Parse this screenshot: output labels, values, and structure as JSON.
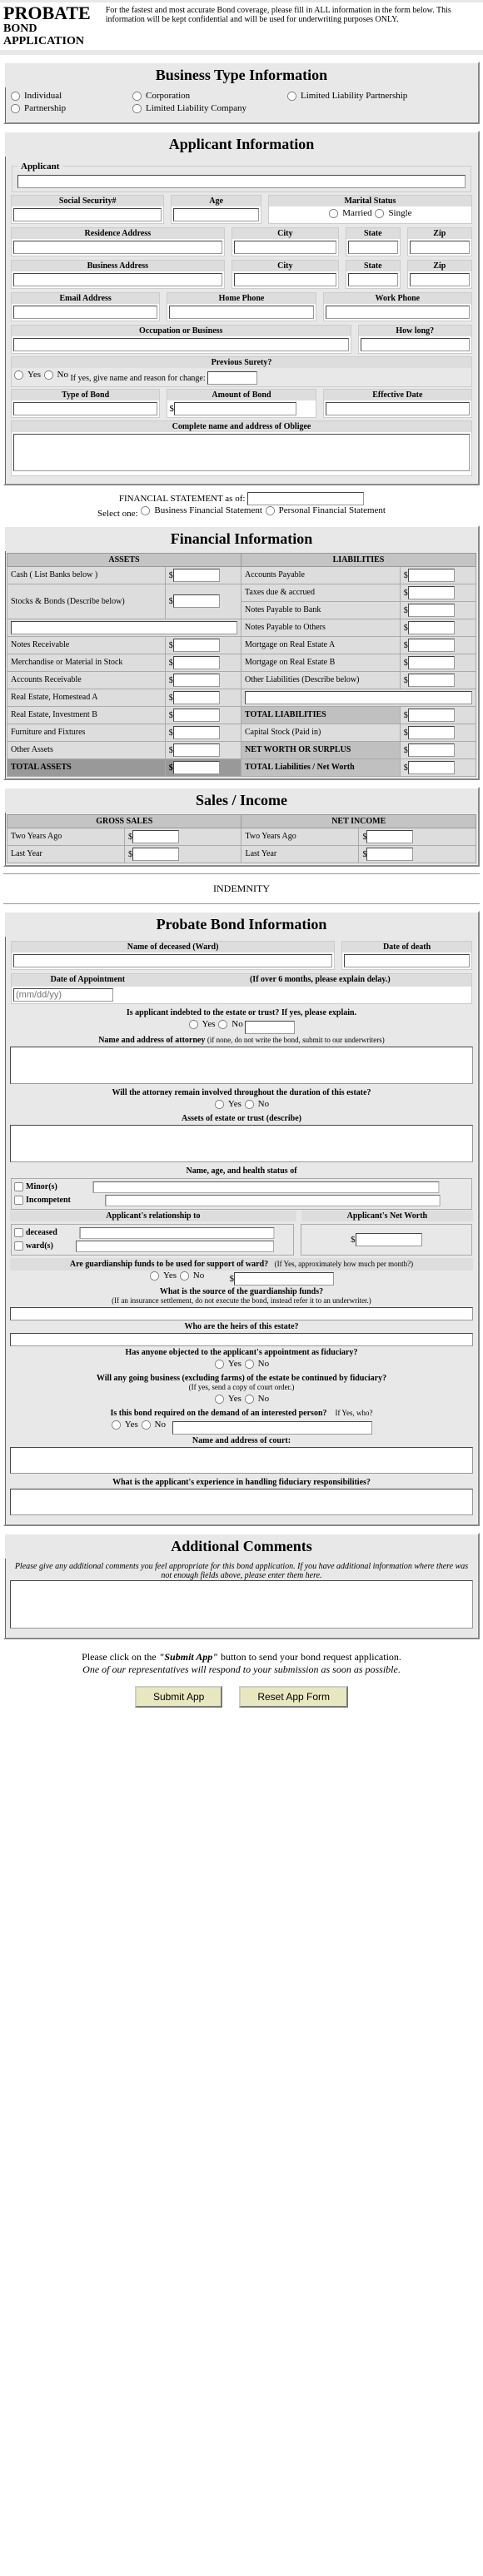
{
  "header": {
    "title_big": "PROBATE",
    "title_line2": "BOND",
    "title_line3": "APPLICATION",
    "subtitle": "For the fastest and most accurate Bond coverage, please fill in ALL information in the form below. This information will be kept confidential and will be used for underwriting purposes ONLY."
  },
  "biz": {
    "title": "Business Type Information",
    "o1": "Individual",
    "o2": "Corporation",
    "o3": "Limited Liability Partnership",
    "o4": "Partnership",
    "o5": "Limited Liability Company"
  },
  "app": {
    "title": "Applicant Information",
    "legend": "Applicant",
    "ssn": "Social Security#",
    "age": "Age",
    "marital": "Marital Status",
    "married": "Married",
    "single": "Single",
    "res": "Residence Address",
    "city": "City",
    "state": "State",
    "zip": "Zip",
    "bus": "Business Address",
    "email": "Email Address",
    "hphone": "Home Phone",
    "wphone": "Work Phone",
    "occ": "Occupation or Business",
    "howlong": "How long?",
    "surety": "Previous Surety?",
    "yes": "Yes",
    "no": "No",
    "surety_note": "If yes, give name and reason for change:",
    "btype": "Type of Bond",
    "bamt": "Amount of Bond",
    "bdate": "Effective Date",
    "obligee": "Complete name and address of Obligee"
  },
  "finstmt": {
    "label": "FINANCIAL STATEMENT as of:",
    "select": "Select one:",
    "o1": "Business Financial Statement",
    "o2": "Personal Financial Statement"
  },
  "fin": {
    "title": "Financial Information",
    "assets": "ASSETS",
    "liab": "LIABILITIES",
    "a1": "Cash ( List Banks below )",
    "a2": "Stocks & Bonds (Describe below)",
    "a3": "Notes Receivable",
    "a4": "Merchandise or Material in Stock",
    "a5": "Accounts Receivable",
    "a6": "Real Estate, Homestead A",
    "a7": "Real Estate, Investment B",
    "a8": "Furniture and Fixtures",
    "a9": "Other Assets",
    "at": "TOTAL ASSETS",
    "l1": "Accounts Payable",
    "l2": "Taxes due & accrued",
    "l3": "Notes Payable to Bank",
    "l4": "Notes Payable to Others",
    "l5": "Mortgage on Real Estate A",
    "l6": "Mortgage on Real Estate B",
    "l7": "Other Liabilities (Describe below)",
    "ltot": "TOTAL LIABILITIES",
    "l8": "Capital Stock (Paid in)",
    "l9": "NET WORTH OR SURPLUS",
    "lt": "TOTAL Liabilities / Net Worth"
  },
  "sales": {
    "title": "Sales / Income",
    "gross": "GROSS SALES",
    "net": "NET INCOME",
    "two": "Two Years Ago",
    "last": "Last Year"
  },
  "indem": "INDEMNITY",
  "prob": {
    "title": "Probate Bond Information",
    "q1": "Name of deceased (Ward)",
    "q1b": "Date of death",
    "q2": "Date of Appointment",
    "q2b": "(If over 6 months, please explain delay.)",
    "q2p": "(mm/dd/yy)",
    "q3": "Is applicant indebted to the estate or trust? If yes, please explain.",
    "yes": "Yes",
    "no": "No",
    "q4": "Name and address of attorney",
    "q4s": "(if none, do not write the bond, submit to our underwriters)",
    "q5": "Will the attorney remain involved throughout the duration of this estate?",
    "q6": "Assets of estate or trust (describe)",
    "q7": "Name, age, and health status of",
    "q7a": "Minor(s)",
    "q7b": "Incompetent",
    "q8a": "Applicant's relationship to",
    "q8b": "Applicant's Net Worth",
    "q8c": "deceased",
    "q8d": "ward(s)",
    "dollar": "$",
    "q9": "Are guardianship funds to be used for support of ward?",
    "q9b": "(If Yes, approximately how much per month?)",
    "q10": "What is the source of the guardianship funds?",
    "q10s": "(If an insurance settlement, do not execute the bond, instead refer it to an underwriter.)",
    "q11": "Who are the heirs of this estate?",
    "q12": "Has anyone objected to the applicant's appointment as fiduciary?",
    "q13": "Will any going business (excluding farms) of the estate be continued by fiduciary?",
    "q13s": "(If yes, send a copy of court order.)",
    "q14": "Is this bond required on the demand of an interested person?",
    "q14b": "If Yes, who?",
    "q15": "Name and address of court:",
    "q16": "What is the applicant's experience in handling fiduciary responsibilities?"
  },
  "addl": {
    "title": "Additional Comments",
    "note": "Please give any additional comments you feel appropriate for this bond application. If you have additional information where there was not enough fields above, please enter them here."
  },
  "footer": {
    "l1a": "Please click on the ",
    "l1b": "\"Submit App\"",
    "l1c": " button to send your bond request application.",
    "l2": "One of our representatives will respond to your submission as soon as possible.",
    "btn1": "Submit App",
    "btn2": "Reset App Form"
  }
}
